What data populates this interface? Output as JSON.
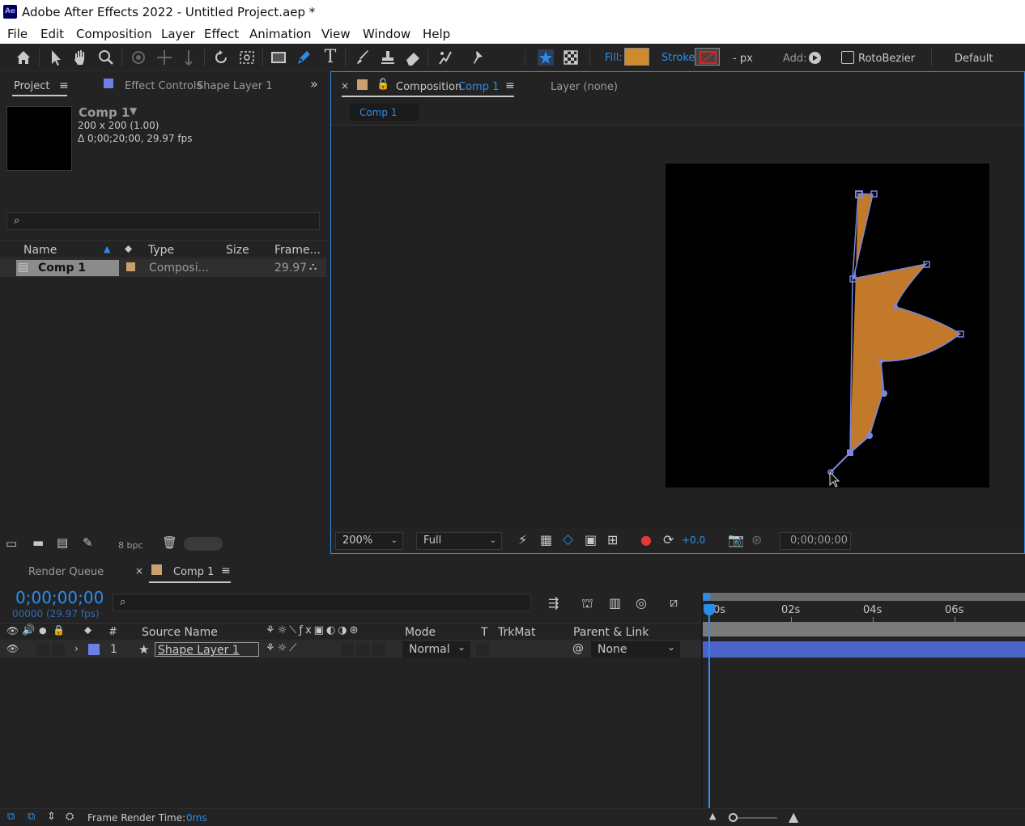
{
  "window": {
    "app_icon": "Ae",
    "title": "Adobe After Effects 2022 - Untitled Project.aep *"
  },
  "menu": [
    "File",
    "Edit",
    "Composition",
    "Layer",
    "Effect",
    "Animation",
    "View",
    "Window",
    "Help"
  ],
  "toolbar": {
    "fill_label": "Fill:",
    "fill_color": "#d08a2c",
    "stroke_label": "Stroke:",
    "stroke_value": "- px",
    "add_label": "Add:",
    "rotobezier_label": "RotoBezier",
    "workspace": "Default",
    "selected_tool": "pen-tool",
    "highlight_color": "#e02020"
  },
  "project_panel": {
    "tab_project": "Project",
    "tab_effect_controls": "Effect Controls",
    "effect_controls_layer": "Shape Layer 1",
    "comp_name": "Comp 1",
    "comp_size": "200 x 200 (1.00)",
    "comp_duration": "Δ 0;00;20;00, 29.97 fps",
    "columns": [
      "Name",
      "Type",
      "Size",
      "Frame..."
    ],
    "items": [
      {
        "name": "Comp 1",
        "type": "Composi...",
        "size": "",
        "frame_rate": "29.97"
      }
    ],
    "bpc": "8 bpc"
  },
  "comp_panel": {
    "tab_label": "Composition",
    "tab_comp": "Comp 1",
    "layer_tab": "Layer (none)",
    "breadcrumb": "Comp 1",
    "zoom": "200%",
    "resolution": "Full",
    "exposure": "+0.0",
    "timecode": "0;00;00;00",
    "shape_fill": "#c27a2a",
    "path_color": "#7a86e0"
  },
  "timeline": {
    "tab_render_queue": "Render Queue",
    "tab_comp": "Comp 1",
    "current_time": "0;00;00;00",
    "frame_info": "00000 (29.97 fps)",
    "columns": {
      "num": "#",
      "source_name": "Source Name",
      "mode": "Mode",
      "t": "T",
      "trkmat": "TrkMat",
      "parent": "Parent & Link"
    },
    "ruler": [
      "0s",
      "02s",
      "04s",
      "06s"
    ],
    "layers": [
      {
        "num": "1",
        "name": "Shape Layer 1",
        "mode": "Normal",
        "parent": "None",
        "label_color": "#6f7fe8"
      }
    ]
  },
  "status": {
    "render_time_label": "Frame Render Time:",
    "render_time_value": "0ms"
  }
}
